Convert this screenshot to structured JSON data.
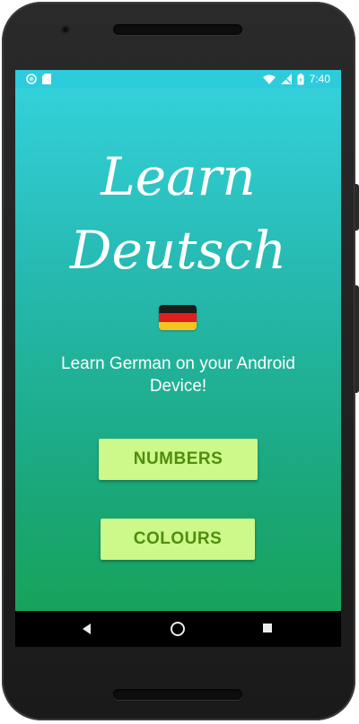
{
  "status_bar": {
    "time": "7:40",
    "left_icons": [
      "circle-notification-icon",
      "sd-card-icon"
    ],
    "right_icons": [
      "wifi-icon",
      "no-signal-icon",
      "battery-icon"
    ]
  },
  "app": {
    "title_line1": "Learn",
    "title_line2": "Deutsch",
    "flag_icon": "germany-flag-icon",
    "subtitle": "Learn German on your Android Device!",
    "buttons": {
      "numbers": "NUMBERS",
      "colours": "COLOURS"
    }
  },
  "nav_bar": {
    "icons": [
      "back-icon",
      "home-icon",
      "recents-icon"
    ]
  },
  "colors": {
    "gradient_top": "#35d3df",
    "gradient_bottom": "#17a35a",
    "button_bg": "#ccf98a",
    "button_text": "#4f8d0d",
    "flag_black": "#1c1c1c",
    "flag_red": "#dd1f1f",
    "flag_gold": "#f6c420"
  }
}
